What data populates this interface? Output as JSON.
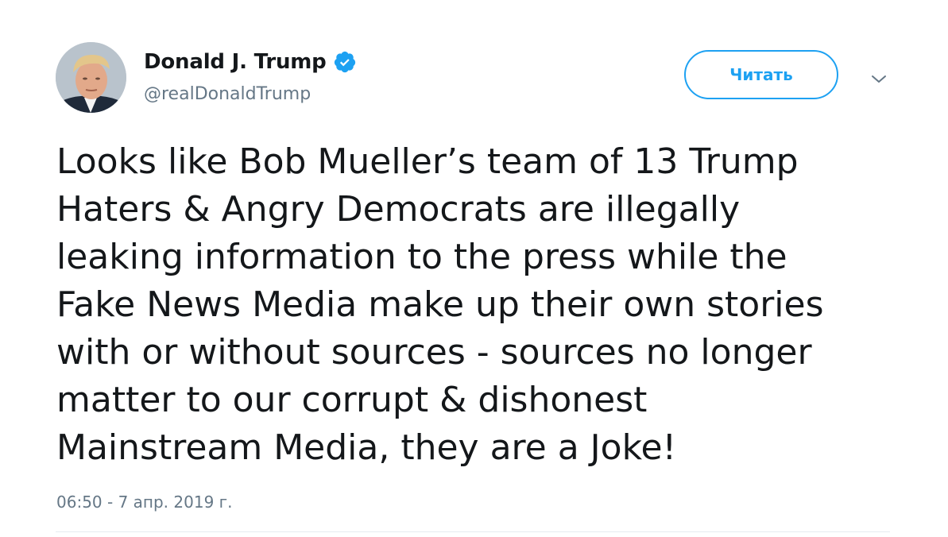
{
  "author": {
    "display_name": "Donald J. Trump",
    "handle": "@realDonaldTrump",
    "verified": true,
    "avatar_icon": "profile-photo"
  },
  "actions": {
    "follow_label": "Читать",
    "menu_icon": "chevron-down-icon"
  },
  "tweet": {
    "lines": [
      "Looks like Bob Mueller’s team of 13 Trump",
      "Haters & Angry Democrats are illegally",
      "leaking information to the press while the",
      "Fake News Media make up their own stories",
      "with or without sources - sources no longer",
      "matter to our corrupt & dishonest",
      "Mainstream Media, they are a Joke!"
    ],
    "timestamp": "06:50 - 7 апр. 2019 г."
  },
  "colors": {
    "accent": "#1da1f2",
    "text": "#14171a",
    "secondary": "#657786",
    "divider": "#e6ecf0"
  }
}
